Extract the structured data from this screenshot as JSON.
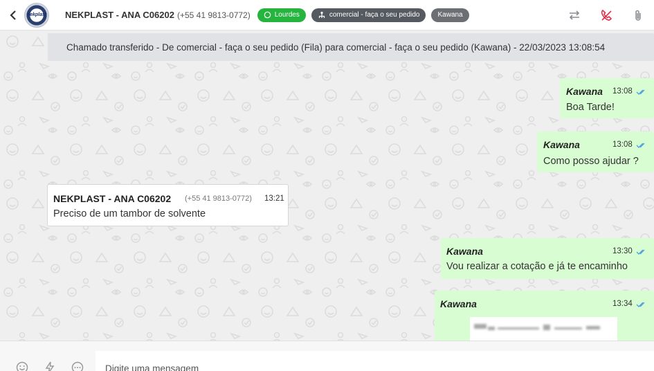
{
  "header": {
    "contact_name": "NEKPLAST - ANA C06202",
    "contact_phone": "(+55 41 9813-0772)",
    "avatar_text": "nekplast",
    "badges": {
      "channel": "Lourdes",
      "queue": "comercial - faça o seu pedido",
      "agent": "Kawana"
    },
    "colors": {
      "channel_badge": "#25b43d",
      "queue_badge": "#555a60",
      "agent_badge": "#6b6f74",
      "hangup_icon": "#e0304a"
    }
  },
  "notice": "Chamado transferido - De comercial - faça o seu pedido (Fila) para comercial - faça o seu pedido (Kawana) - 22/03/2023 13:08:54",
  "messages": [
    {
      "direction": "out",
      "sender": "Kawana",
      "time": "13:08",
      "text": "Boa Tarde!",
      "status": "read"
    },
    {
      "direction": "out",
      "sender": "Kawana",
      "time": "13:08",
      "text": "Como posso ajudar ?",
      "status": "read"
    },
    {
      "direction": "in",
      "sender": "NEKPLAST - ANA C06202",
      "phone": "(+55 41 9813-0772)",
      "time": "13:21",
      "text": "Preciso de um tambor de solvente"
    },
    {
      "direction": "out",
      "sender": "Kawana",
      "time": "13:30",
      "text": "Vou realizar a cotação e já te encaminho",
      "status": "read"
    },
    {
      "direction": "out",
      "sender": "Kawana",
      "time": "13:34",
      "text": "",
      "status": "read",
      "attachment": "image"
    }
  ],
  "composer": {
    "placeholder": "Digite uma mensagem"
  },
  "theme": {
    "outgoing_bubble": "#d9fdd2",
    "incoming_bubble": "#ffffff",
    "chat_background": "#efefef",
    "read_ticks": "#4fa3e0"
  }
}
